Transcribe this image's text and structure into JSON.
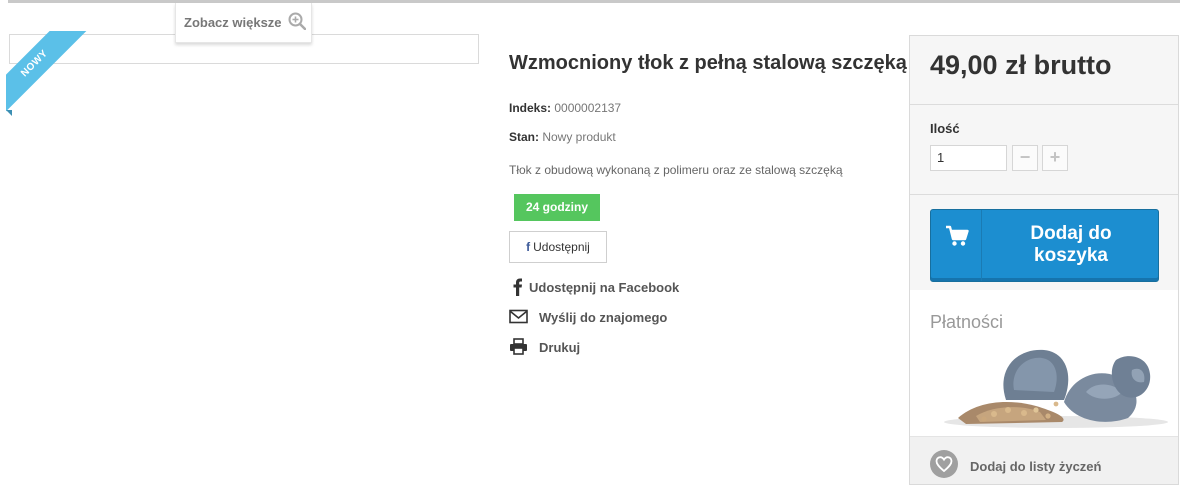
{
  "gallery": {
    "zoom_label": "Zobacz większe",
    "ribbon_label": "NOWY"
  },
  "product": {
    "title": "Wzmocniony tłok z pełną stalową szczęką",
    "index_label": "Indeks:",
    "index_value": "0000002137",
    "condition_label": "Stan:",
    "condition_value": "Nowy produkt",
    "description": "Tłok z obudową wykonaną z polimeru oraz ze stalową szczęką",
    "delivery_badge": "24 godziny",
    "delivery_badge_color": "#55c65e",
    "share_button_label": "Udostępnij",
    "actions": [
      {
        "label": "Udostępnij na Facebook",
        "icon": "facebook-icon"
      },
      {
        "label": "Wyślij do znajomego",
        "icon": "envelope-icon"
      },
      {
        "label": "Drukuj",
        "icon": "printer-icon"
      }
    ]
  },
  "buybox": {
    "price": "49,00 zł brutto",
    "quantity_label": "Ilość",
    "quantity_value": "1",
    "minus_label": "−",
    "plus_label": "+",
    "add_to_cart_line1": "Dodaj do",
    "add_to_cart_line2": "koszyka",
    "add_to_cart_color": "#1c8ed0",
    "payments_title": "Płatności",
    "wishlist_label": "Dodaj do listy życzeń"
  }
}
